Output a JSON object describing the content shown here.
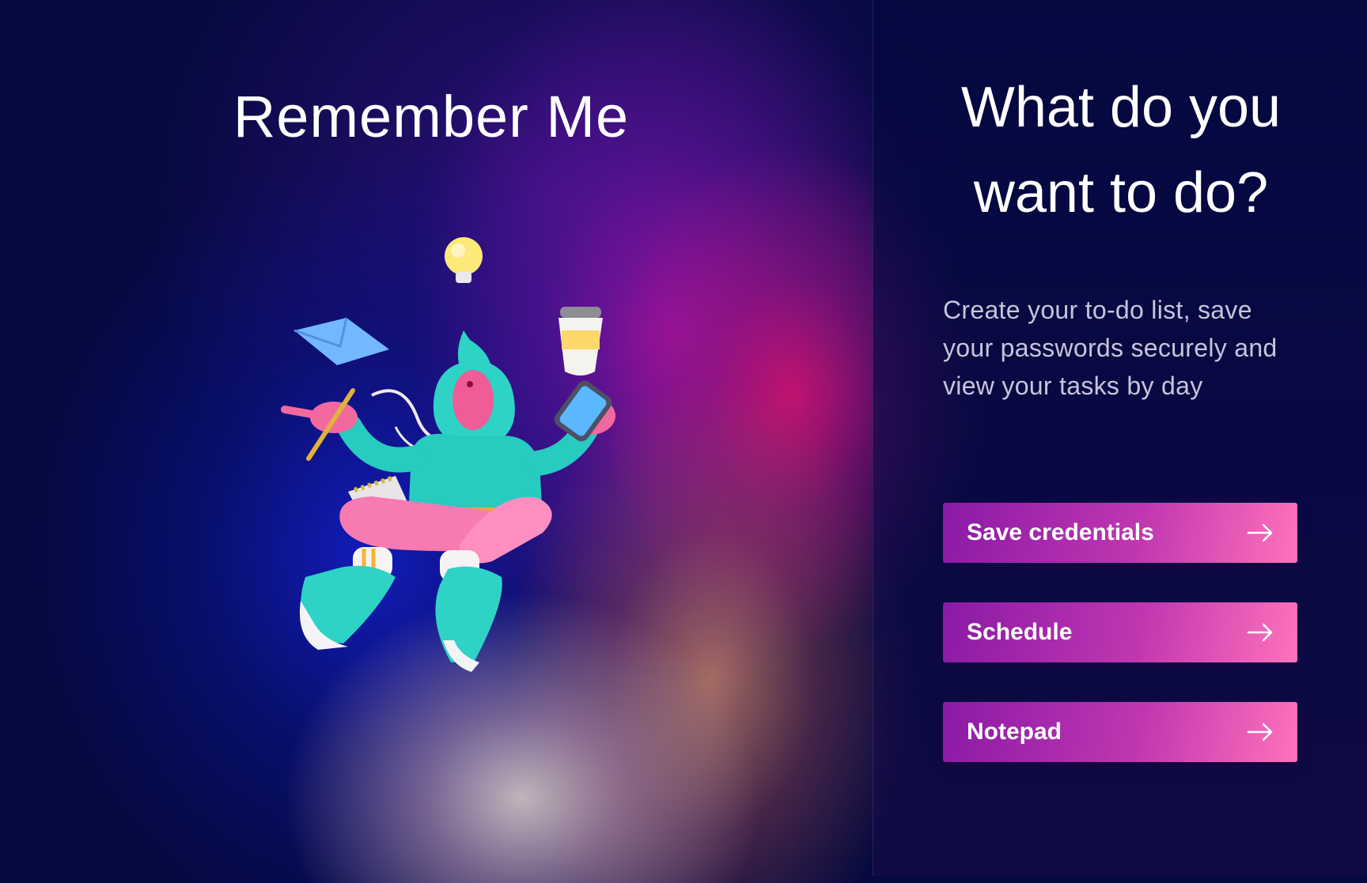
{
  "app": {
    "title": "Remember Me"
  },
  "panel": {
    "heading": "What do you want to do?",
    "description": "Create your to-do list, save your passwords securely and view your tasks by day"
  },
  "actions": [
    {
      "label": "Save credentials",
      "icon": "arrow-right-icon"
    },
    {
      "label": "Schedule",
      "icon": "arrow-right-icon"
    },
    {
      "label": "Notepad",
      "icon": "arrow-right-icon"
    }
  ],
  "illustration": {
    "icon": "multitasking-character-illustration"
  },
  "colors": {
    "background": "#05093e",
    "button_start": "#8a1aa6",
    "button_end": "#ff72bb",
    "text_primary": "#ffffff",
    "text_muted": "#c8c4dc"
  }
}
